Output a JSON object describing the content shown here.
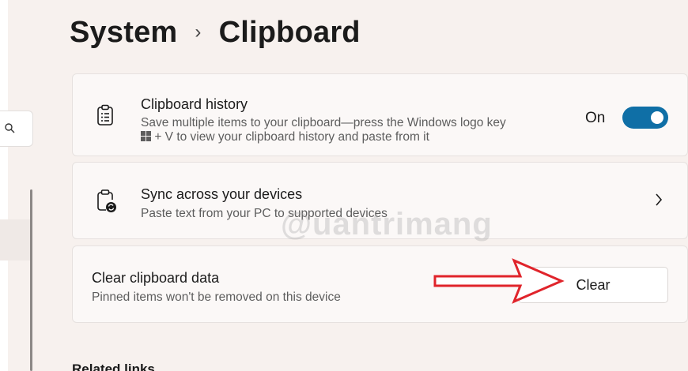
{
  "breadcrumb": {
    "parent": "System",
    "separator": "›",
    "current": "Clipboard"
  },
  "history": {
    "title": "Clipboard history",
    "desc_line1": "Save multiple items to your clipboard—press the Windows logo key",
    "desc_line2": "+ V to view your clipboard history and paste from it",
    "toggle_label": "On",
    "toggle_on": true
  },
  "sync": {
    "title": "Sync across your devices",
    "desc": "Paste text from your PC to supported devices"
  },
  "clear": {
    "title": "Clear clipboard data",
    "desc": "Pinned items won't be removed on this device",
    "button_label": "Clear"
  },
  "related": {
    "heading": "Related links"
  },
  "watermark": "@uantrimang",
  "colors": {
    "accent": "#0f6fa6",
    "arrow": "#e0242b"
  },
  "icons": {
    "search": "search-icon",
    "history": "clipboard-list-icon",
    "sync": "clipboard-sync-icon",
    "chevron": "chevron-right-icon",
    "arrow": "red-arrow-annotation"
  }
}
